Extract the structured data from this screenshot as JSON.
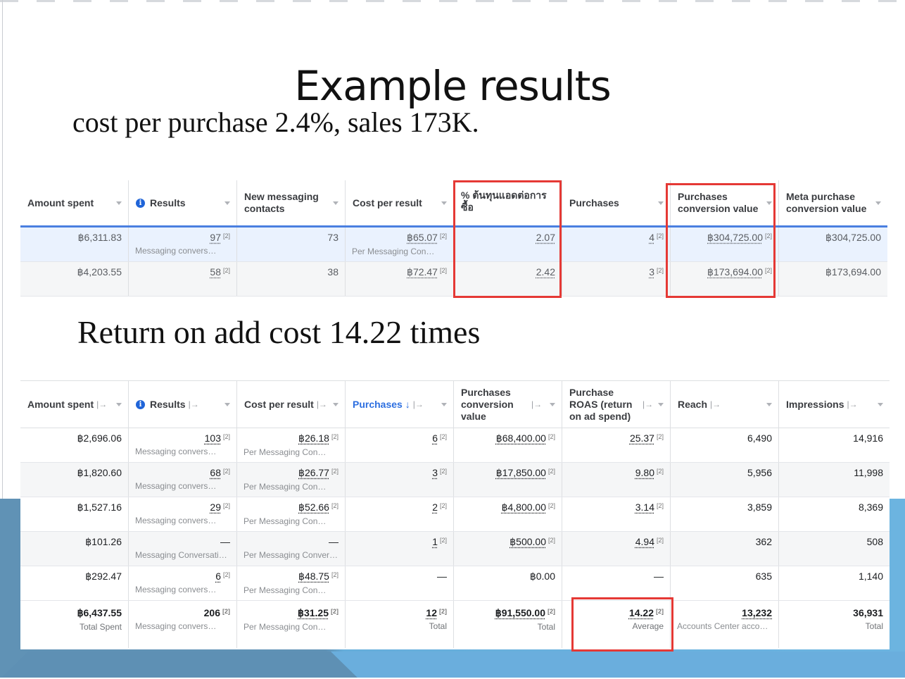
{
  "slide": {
    "title": "Example results",
    "subtitle_1": "cost per purchase 2.4%, sales 173K.",
    "subtitle_2": "Return on add cost 14.22 times"
  },
  "table1": {
    "headers": [
      "Amount spent",
      "Results",
      "New messaging contacts",
      "Cost per result",
      "% ต้นทุนแอดต่อการซื้อ",
      "Purchases",
      "Purchases conversion value",
      "Meta purchase conversion value"
    ],
    "rows": [
      {
        "amount": "฿6,311.83",
        "results": "97",
        "results_note": "Messaging convers…",
        "new_contacts": "73",
        "cost_per_result": "฿65.07",
        "cost_note": "Per Messaging Con…",
        "pct": "2.07",
        "purchases": "4",
        "conv_value": "฿304,725.00",
        "meta_value": "฿304,725.00"
      },
      {
        "amount": "฿4,203.55",
        "results": "58",
        "results_note": "",
        "new_contacts": "38",
        "cost_per_result": "฿72.47",
        "cost_note": "",
        "pct": "2.42",
        "purchases": "3",
        "conv_value": "฿173,694.00",
        "meta_value": "฿173,694.00"
      }
    ],
    "ref": "[2]"
  },
  "table2": {
    "headers": [
      "Amount spent",
      "Results",
      "Cost per result",
      "Purchases ↓",
      "Purchases conversion value",
      "Purchase ROAS (return on ad spend)",
      "Reach",
      "Impressions"
    ],
    "rows": [
      {
        "amount": "฿2,696.06",
        "results": "103",
        "results_note": "Messaging convers…",
        "cost": "฿26.18",
        "cost_note": "Per Messaging Con…",
        "purchases": "6",
        "conv_value": "฿68,400.00",
        "roas": "25.37",
        "reach": "6,490",
        "impressions": "14,916"
      },
      {
        "amount": "฿1,820.60",
        "results": "68",
        "results_note": "Messaging convers…",
        "cost": "฿26.77",
        "cost_note": "Per Messaging Con…",
        "purchases": "3",
        "conv_value": "฿17,850.00",
        "roas": "9.80",
        "reach": "5,956",
        "impressions": "11,998"
      },
      {
        "amount": "฿1,527.16",
        "results": "29",
        "results_note": "Messaging convers…",
        "cost": "฿52.66",
        "cost_note": "Per Messaging Con…",
        "purchases": "2",
        "conv_value": "฿4,800.00",
        "roas": "3.14",
        "reach": "3,859",
        "impressions": "8,369"
      },
      {
        "amount": "฿101.26",
        "results": "—",
        "results_note": "Messaging Conversati…",
        "cost": "—",
        "cost_note": "Per Messaging Conver…",
        "purchases": "1",
        "conv_value": "฿500.00",
        "roas": "4.94",
        "reach": "362",
        "impressions": "508"
      },
      {
        "amount": "฿292.47",
        "results": "6",
        "results_note": "Messaging convers…",
        "cost": "฿48.75",
        "cost_note": "Per Messaging Con…",
        "purchases": "—",
        "conv_value": "฿0.00",
        "roas": "—",
        "reach": "635",
        "impressions": "1,140"
      }
    ],
    "totals": {
      "amount": "฿6,437.55",
      "amount_note": "Total Spent",
      "results": "206",
      "results_note": "Messaging convers…",
      "cost": "฿31.25",
      "cost_note": "Per Messaging Con…",
      "purchases": "12",
      "purchases_note": "Total",
      "conv_value": "฿91,550.00",
      "conv_note": "Total",
      "roas": "14.22",
      "roas_note": "Average",
      "reach": "13,232",
      "reach_note": "Accounts Center acco…",
      "impressions": "36,931",
      "impressions_note": "Total"
    },
    "ref": "[2]"
  }
}
